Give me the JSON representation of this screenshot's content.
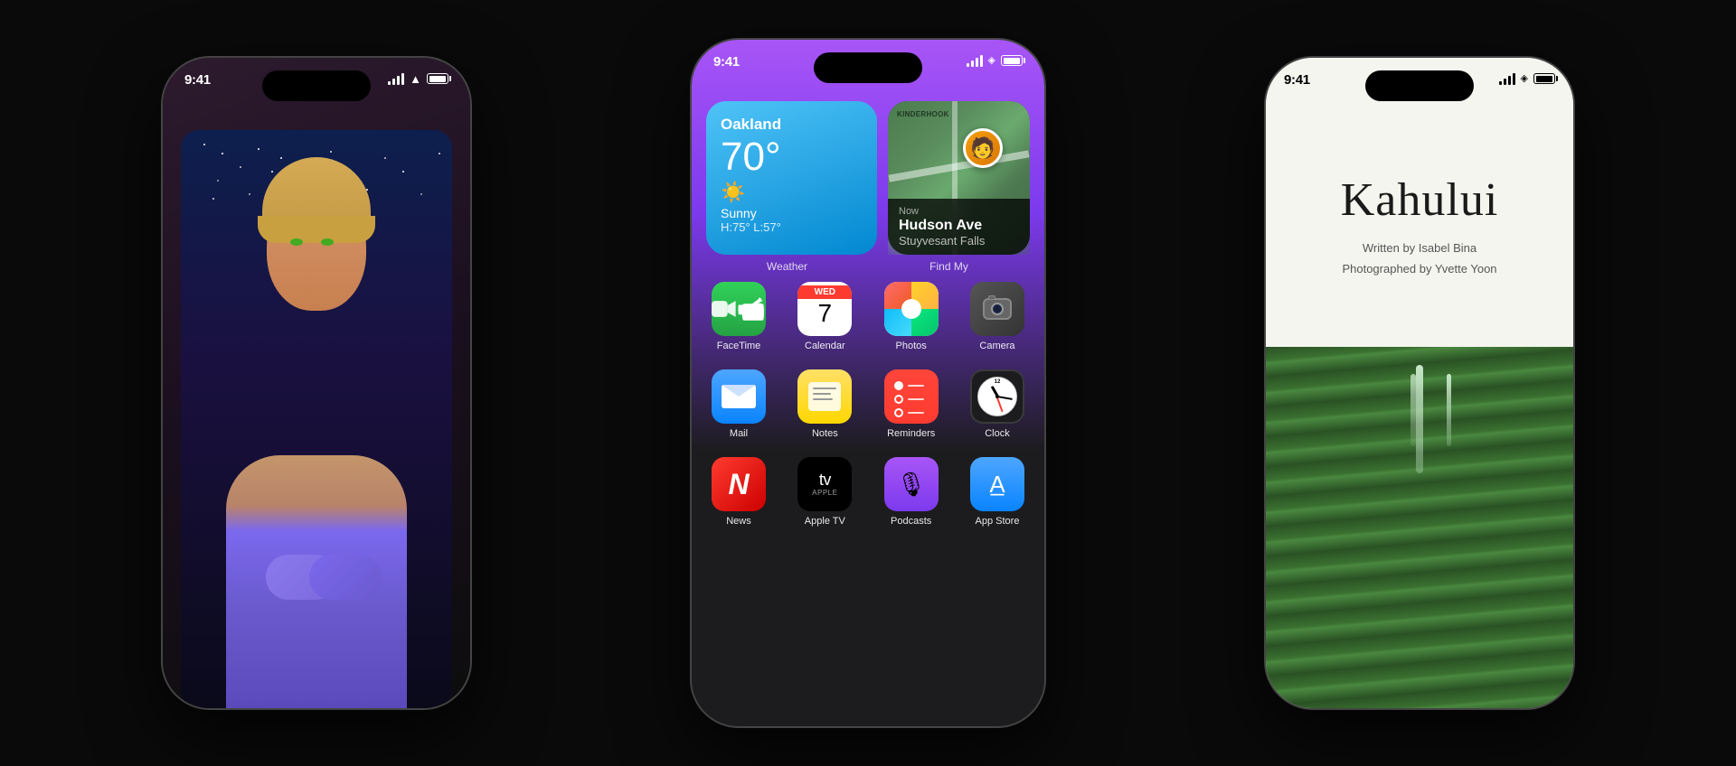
{
  "scene": {
    "background": "#0a0a0a"
  },
  "left_phone": {
    "time": "9:41",
    "status_icons": {
      "signal": "●●●",
      "wifi": "wifi",
      "battery": "100"
    }
  },
  "center_phone": {
    "time": "9:41",
    "status_icons": {
      "signal": "●●●",
      "wifi": "wifi",
      "battery": "100"
    },
    "weather_widget": {
      "city": "Oakland",
      "temperature": "70°",
      "condition": "Sunny",
      "high_low": "H:75° L:57°",
      "label": "Weather"
    },
    "findmy_widget": {
      "time": "Now",
      "street": "Hudson Ave",
      "city": "Stuyvesant Falls",
      "label": "Find My"
    },
    "apps_row1": [
      {
        "name": "FaceTime",
        "icon": "facetime"
      },
      {
        "name": "Calendar",
        "icon": "calendar",
        "day_label": "WED",
        "day_num": "7"
      },
      {
        "name": "Photos",
        "icon": "photos"
      },
      {
        "name": "Camera",
        "icon": "camera"
      }
    ],
    "apps_row2": [
      {
        "name": "Mail",
        "icon": "mail"
      },
      {
        "name": "Notes",
        "icon": "notes"
      },
      {
        "name": "Reminders",
        "icon": "reminders"
      },
      {
        "name": "Clock",
        "icon": "clock"
      }
    ],
    "apps_row3": [
      {
        "name": "News",
        "icon": "news"
      },
      {
        "name": "Apple TV",
        "icon": "appletv"
      },
      {
        "name": "Podcasts",
        "icon": "podcasts"
      },
      {
        "name": "App Store",
        "icon": "appstore"
      }
    ]
  },
  "right_phone": {
    "time": "9:41",
    "title": "Kahului",
    "written_by": "Written by Isabel Bina",
    "photographed_by": "Photographed by Yvette Yoon"
  }
}
